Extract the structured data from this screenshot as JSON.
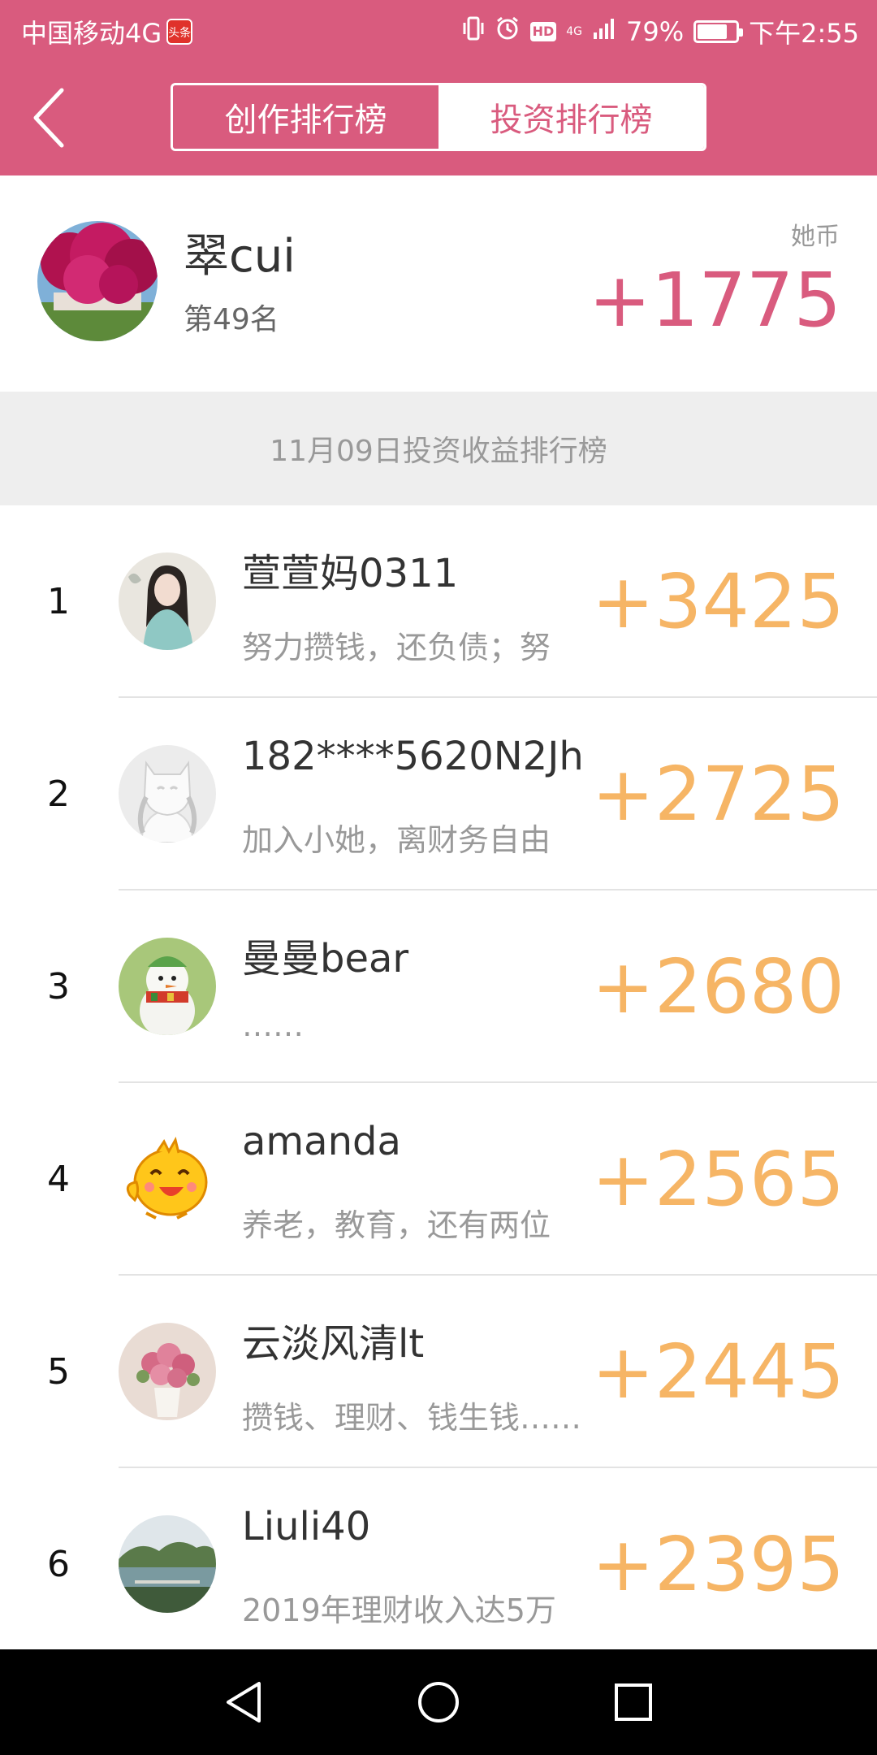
{
  "status_bar": {
    "carrier": "中国移动4G",
    "app_badge": "头条",
    "hd": "HD",
    "network": "4G",
    "battery_pct": "79%",
    "battery_level": 0.79,
    "time": "下午2:55"
  },
  "nav": {
    "tabs": [
      {
        "label": "创作排行榜",
        "active": true
      },
      {
        "label": "投资排行榜",
        "active": false
      }
    ]
  },
  "me": {
    "name": "翠cui",
    "rank": "第49名",
    "currency": "她币",
    "score": "+1775"
  },
  "section_title": "11月09日投资收益排行榜",
  "ranking": [
    {
      "rank": "1",
      "name": "萱萱妈0311",
      "bio": "努力攒钱，还负债；努",
      "score": "+3425",
      "avatar": "woman-portrait-avatar"
    },
    {
      "rank": "2",
      "name": "182****5620N2Jh",
      "bio": "加入小她，离财务自由",
      "score": "+2725",
      "avatar": "default-user-avatar"
    },
    {
      "rank": "3",
      "name": "曼曼bear",
      "bio": "……",
      "score": "+2680",
      "avatar": "snowman-avatar"
    },
    {
      "rank": "4",
      "name": "amanda",
      "bio": "养老，教育，还有两位",
      "score": "+2565",
      "avatar": "cartoon-chick-avatar"
    },
    {
      "rank": "5",
      "name": "云淡风清lt",
      "bio": "攒钱、理财、钱生钱……",
      "score": "+2445",
      "avatar": "rose-bouquet-avatar"
    },
    {
      "rank": "6",
      "name": "Liuli40",
      "bio": "2019年理财收入达5万",
      "score": "+2395",
      "avatar": "lake-landscape-avatar"
    }
  ],
  "colors": {
    "brand": "#D95B7E",
    "score_orange": "#F6B565",
    "section_bg": "#EEEEEE"
  }
}
